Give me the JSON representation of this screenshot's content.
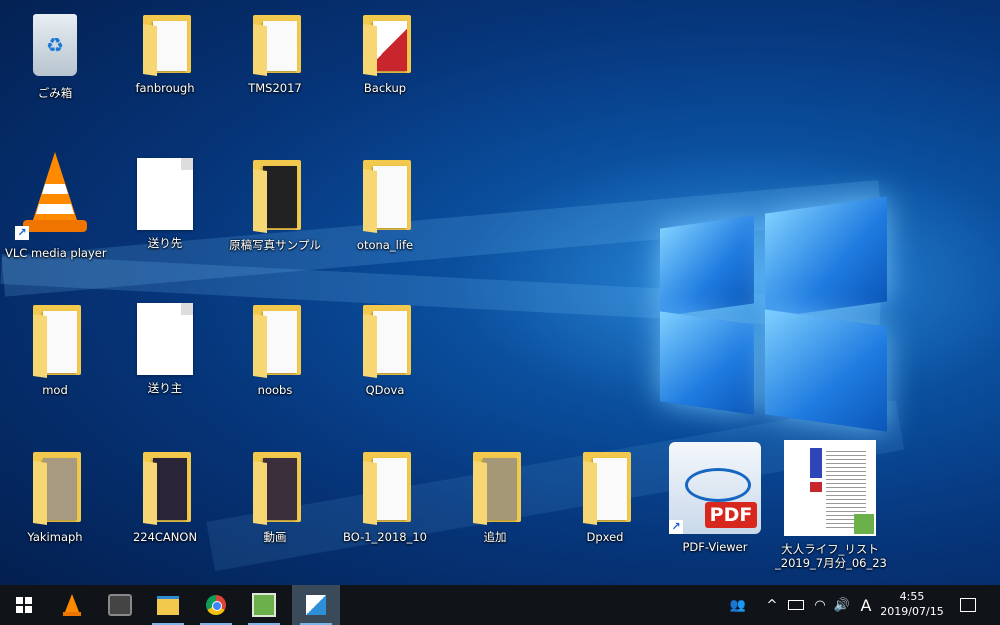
{
  "desktop": {
    "icons": [
      {
        "label": "ごみ箱",
        "icon": "recycle-bin-icon"
      },
      {
        "label": "fanbrough",
        "icon": "folder-icon"
      },
      {
        "label": "TMS2017",
        "icon": "folder-icon"
      },
      {
        "label": "Backup",
        "icon": "folder-icon"
      },
      {
        "label": "VLC media player",
        "icon": "vlc-cone-icon"
      },
      {
        "label": "送り先",
        "icon": "blank-file-icon"
      },
      {
        "label": "原稿写真サンプル",
        "icon": "folder-icon"
      },
      {
        "label": "otona_life",
        "icon": "folder-icon"
      },
      {
        "label": "mod",
        "icon": "folder-icon"
      },
      {
        "label": "送り主",
        "icon": "blank-file-icon"
      },
      {
        "label": "noobs",
        "icon": "folder-icon"
      },
      {
        "label": "QDova",
        "icon": "folder-icon"
      },
      {
        "label": "Yakimaph",
        "icon": "folder-icon"
      },
      {
        "label": "224CANON",
        "icon": "folder-icon"
      },
      {
        "label": "動画",
        "icon": "folder-icon"
      },
      {
        "label": "BO-1_2018_10",
        "icon": "folder-icon"
      },
      {
        "label": "追加",
        "icon": "folder-icon"
      },
      {
        "label": "Dpxed",
        "icon": "folder-icon"
      },
      {
        "label": "PDF-Viewer",
        "icon": "pdf-viewer-icon",
        "pdf_text": "PDF"
      },
      {
        "label": "大人ライフ_リスト_2019_7月分_06_23",
        "label_line1": "大人ライフ_リスト",
        "label_line2": "_2019_7月分_06_23",
        "icon": "spreadsheet-thumbnail-icon"
      }
    ]
  },
  "taskbar": {
    "apps": [
      {
        "name": "start",
        "icon": "windows-logo-icon"
      },
      {
        "name": "vlc",
        "icon": "vlc-cone-icon"
      },
      {
        "name": "camera-app",
        "icon": "camera-icon"
      },
      {
        "name": "file-explorer",
        "icon": "folder-icon"
      },
      {
        "name": "chrome",
        "icon": "chrome-icon"
      },
      {
        "name": "spreadsheet-app",
        "icon": "spreadsheet-icon"
      },
      {
        "name": "active-app",
        "icon": "pen-app-icon"
      }
    ],
    "tray": {
      "people": "people-icon",
      "chevron": "^",
      "ime": "A",
      "time": "4:55",
      "date": "2019/07/15"
    }
  },
  "colors": {
    "folder": "#f2c94c",
    "taskbar": "#101418",
    "accent": "#7fb6e8"
  }
}
